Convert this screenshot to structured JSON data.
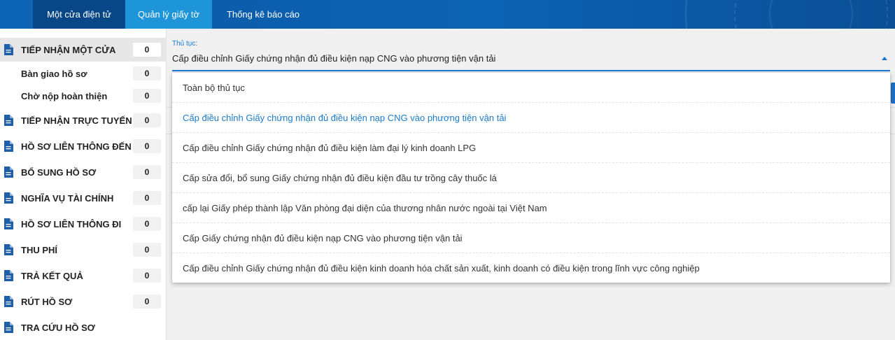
{
  "nav": {
    "tabs": [
      {
        "label": "Một cửa điện tử",
        "active": true
      },
      {
        "label": "Quản lý giấy tờ",
        "active": false
      },
      {
        "label": "Thống kê báo cáo",
        "active": false
      }
    ]
  },
  "sidebar": {
    "items": [
      {
        "label": "TIẾP NHẬN MỘT CỬA",
        "count": "0",
        "icon": "document-icon",
        "active": true
      },
      {
        "label": "Bàn giao hồ sơ",
        "count": "0",
        "sub": true
      },
      {
        "label": "Chờ nộp hoàn thiện",
        "count": "0",
        "sub": true
      },
      {
        "label": "TIẾP NHẬN TRỰC TUYẾN",
        "count": "0",
        "icon": "document-icon"
      },
      {
        "label": "HỒ SƠ LIÊN THÔNG ĐẾN",
        "count": "0",
        "icon": "document-icon"
      },
      {
        "label": "BỔ SUNG HỒ SƠ",
        "count": "0",
        "icon": "document-icon"
      },
      {
        "label": "NGHĨA VỤ TÀI CHÍNH",
        "count": "0",
        "icon": "document-icon"
      },
      {
        "label": "HỒ SƠ LIÊN THÔNG ĐI",
        "count": "0",
        "icon": "document-icon"
      },
      {
        "label": "THU PHÍ",
        "count": "0",
        "icon": "document-icon"
      },
      {
        "label": "TRẢ KẾT QUẢ",
        "count": "0",
        "icon": "document-icon"
      },
      {
        "label": "RÚT HỒ SƠ",
        "count": "0",
        "icon": "document-icon"
      },
      {
        "label": "TRA CỨU HỒ SƠ",
        "icon": "document-icon"
      }
    ]
  },
  "procedure_select": {
    "label": "Thủ tục:",
    "value": "Cấp điều chỉnh Giấy chứng nhận đủ điều kiện nạp CNG vào phương tiện vận tải",
    "options": [
      "Toàn bộ thủ tục",
      "Cấp điều chỉnh Giấy chứng nhận đủ điều kiện nạp CNG vào phương tiện vận tải",
      "Cấp điều chỉnh Giấy chứng nhận đủ điều kiện làm đại lý kinh doanh LPG",
      "Cấp sửa đổi, bổ sung Giấy chứng nhận đủ điều kiện đầu tư trồng cây thuốc lá",
      "cấp lại Giấy phép thành lập Văn phòng đại diện của thương nhân nước ngoài tại Việt Nam",
      "Cấp Giấy chứng nhận đủ điều kiện nạp CNG vào phương tiện vận tải",
      "Cấp điều chỉnh Giấy chứng nhận đủ điều kiện kinh doanh hóa chất sản xuất, kinh doanh có điều kiện trong lĩnh vực công nghiệp"
    ],
    "selected_index": 1
  },
  "colors": {
    "accent": "#1976d2",
    "nav_bg": "#0c62b4",
    "nav_active": "#084787",
    "nav_hover": "#1f95d9",
    "icon": "#1e5fa8"
  }
}
